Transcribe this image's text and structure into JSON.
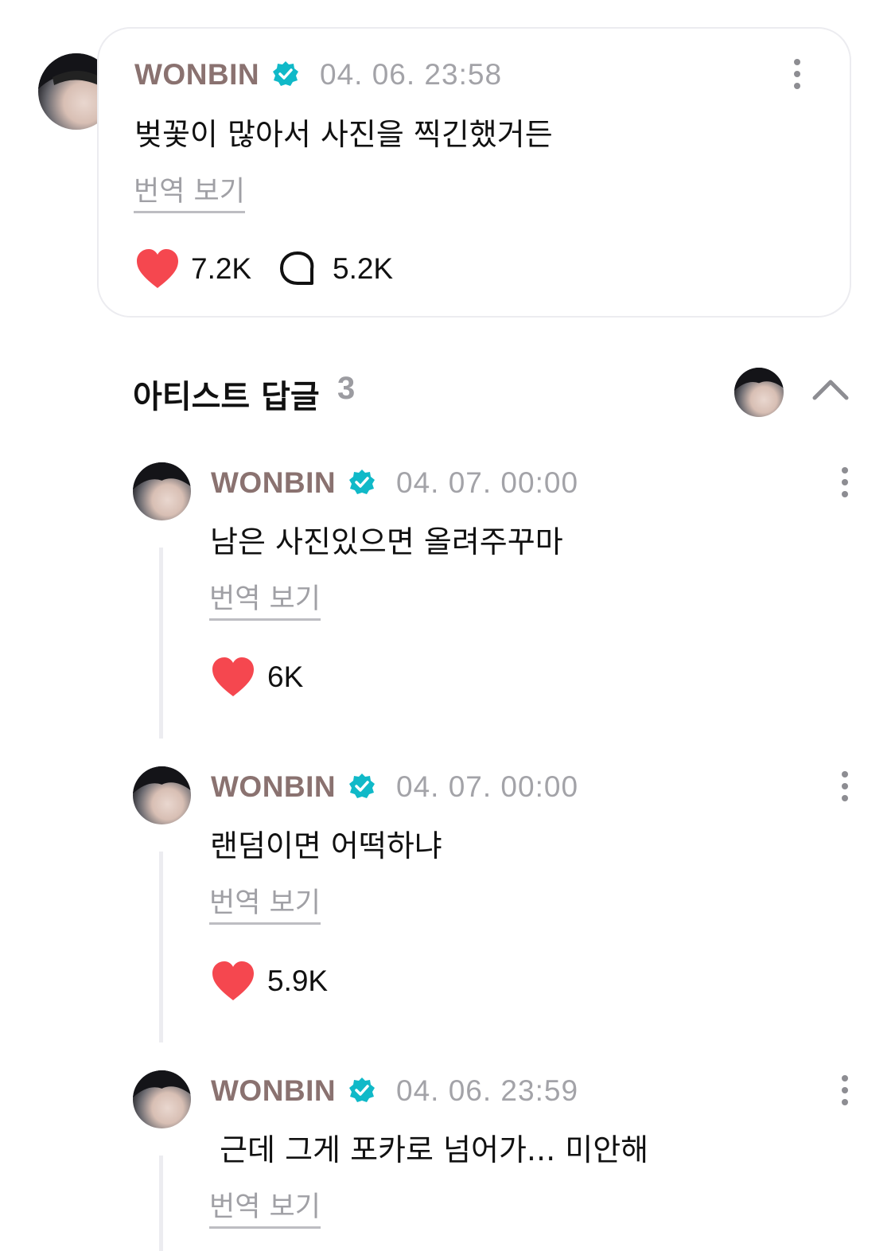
{
  "post": {
    "author": "WONBIN",
    "timestamp": "04. 06. 23:58",
    "text": "벚꽃이 많아서 사진을 찍긴했거든",
    "translate_label": "번역 보기",
    "likes": "7.2K",
    "comments": "5.2K"
  },
  "replies_section": {
    "title": "아티스트 답글",
    "count": "3"
  },
  "replies": [
    {
      "author": "WONBIN",
      "timestamp": "04. 07. 00:00",
      "text": "남은 사진있으면 올려주꾸마",
      "translate_label": "번역 보기",
      "likes": "6K"
    },
    {
      "author": "WONBIN",
      "timestamp": "04. 07. 00:00",
      "text": "랜덤이면 어떡하냐",
      "translate_label": "번역 보기",
      "likes": "5.9K"
    },
    {
      "author": "WONBIN",
      "timestamp": "04. 06. 23:59",
      "text": " 근데 그게 포카로 넘어가... 미안해",
      "translate_label": "번역 보기"
    }
  ],
  "colors": {
    "author": "#8a7270",
    "verified": "#10b9c8",
    "heart": "#f5474f",
    "muted": "#a3a3a8"
  },
  "icons": {
    "verified": "verified-badge-icon",
    "like": "heart-icon",
    "comment": "comment-bubble-icon",
    "more": "more-vertical-icon",
    "collapse": "chevron-up-icon"
  }
}
